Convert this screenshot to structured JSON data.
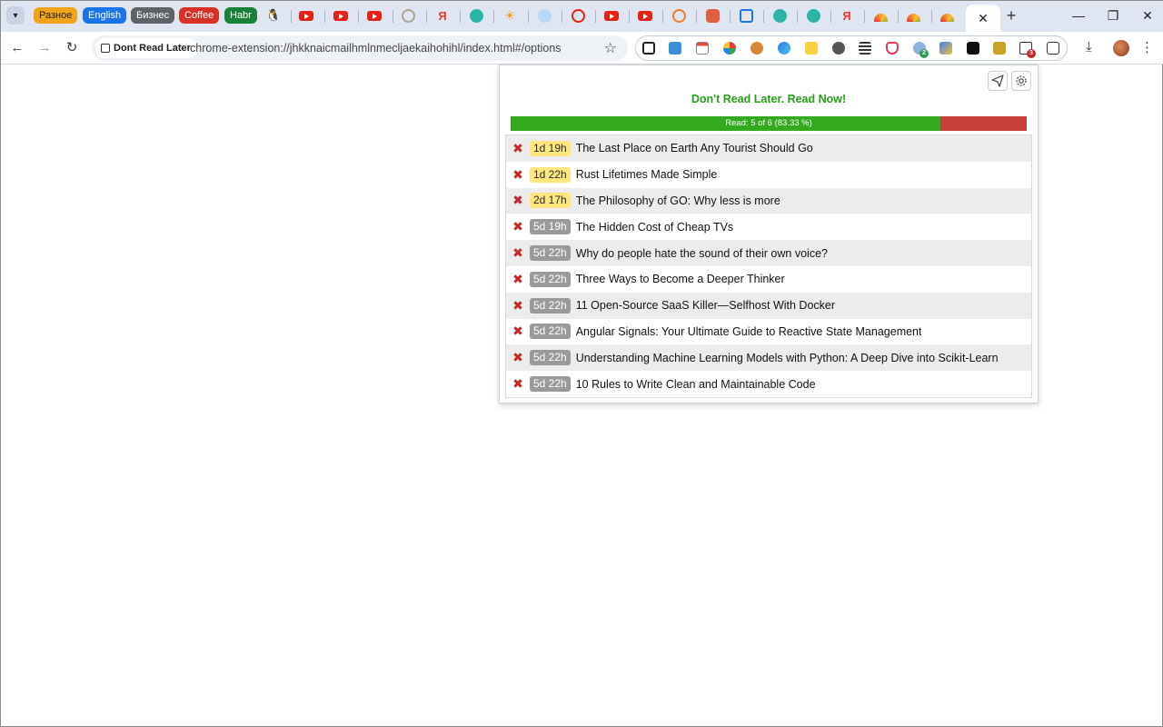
{
  "browser": {
    "tab_groups": [
      {
        "label": "Разное",
        "color": "#f2a418",
        "text_color": "#1f1f1f"
      },
      {
        "label": "English",
        "color": "#1a73e8",
        "text_color": "#ffffff"
      },
      {
        "label": "Бизнес",
        "color": "#5f6368",
        "text_color": "#ffffff"
      },
      {
        "label": "Coffee",
        "color": "#d93025",
        "text_color": "#ffffff"
      },
      {
        "label": "Habr",
        "color": "#188038",
        "text_color": "#ffffff"
      }
    ],
    "active_tab_close": "✕",
    "new_tab": "+",
    "window_controls": {
      "minimize": "—",
      "restore": "❐",
      "close": "✕"
    }
  },
  "toolbar": {
    "site_chip_label": "Dont Read Later",
    "url": "chrome-extension://jhkknaicmailhmlnmecljaekaihohihl/index.html#/options",
    "extension_badges": {
      "ext_a": "2",
      "drl": "3"
    }
  },
  "popup": {
    "title": "Don't Read Later. Read Now!",
    "progress": {
      "label": "Read: 5 of 6 (83.33 %)",
      "read": 5,
      "total": 6,
      "fraction": 0.8333,
      "fill_color": "#33a91e",
      "remaining_color": "#c8403b"
    },
    "items": [
      {
        "age": "1d 19h",
        "title": "The Last Place on Earth Any Tourist Should Go",
        "status": "recent"
      },
      {
        "age": "1d 22h",
        "title": "Rust Lifetimes Made Simple",
        "status": "recent"
      },
      {
        "age": "2d 17h",
        "title": "The Philosophy of GO: Why less is more",
        "status": "recent"
      },
      {
        "age": "5d 19h",
        "title": "The Hidden Cost of Cheap TVs",
        "status": "old"
      },
      {
        "age": "5d 22h",
        "title": "Why do people hate the sound of their own voice?",
        "status": "old"
      },
      {
        "age": "5d 22h",
        "title": "Three Ways to Become a Deeper Thinker",
        "status": "old"
      },
      {
        "age": "5d 22h",
        "title": "11 Open-Source SaaS Killer—Selfhost With Docker",
        "status": "old"
      },
      {
        "age": "5d 22h",
        "title": "Angular Signals: Your Ultimate Guide to Reactive State Management",
        "status": "old"
      },
      {
        "age": "5d 22h",
        "title": "Understanding Machine Learning Models with Python: A Deep Dive into Scikit-Learn",
        "status": "old"
      },
      {
        "age": "5d 22h",
        "title": "10 Rules to Write Clean and Maintainable Code",
        "status": "old"
      }
    ]
  }
}
